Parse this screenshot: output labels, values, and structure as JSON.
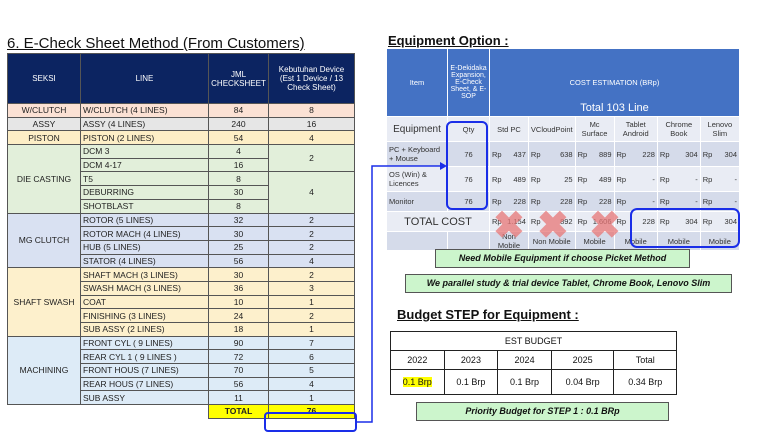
{
  "left": {
    "title": "6. E-Check Sheet Method (From Customers)",
    "headers": [
      "SEKSI",
      "LINE",
      "JML CHECKSHEET",
      "Kebutuhan Device (Est 1 Device / 13 Check Sheet)"
    ],
    "groups": [
      {
        "seksi": "W/CLUTCH",
        "cls": "wc",
        "rows": [
          [
            "W/CLUTCH (4 LINES)",
            "84"
          ]
        ],
        "dev": [
          "8"
        ]
      },
      {
        "seksi": "ASSY",
        "cls": "as",
        "rows": [
          [
            "ASSY (4 LINES)",
            "240"
          ]
        ],
        "dev": [
          "16"
        ]
      },
      {
        "seksi": "PISTON",
        "cls": "pi",
        "rows": [
          [
            "PISTON (2 LINES)",
            "54"
          ]
        ],
        "dev": [
          "4"
        ]
      },
      {
        "seksi": "DIE CASTING",
        "cls": "dc",
        "rows": [
          [
            "DCM 3",
            "4"
          ],
          [
            "DCM 4-17",
            "16"
          ],
          [
            "T5",
            "8"
          ],
          [
            "DEBURRING",
            "30"
          ],
          [
            "SHOTBLAST",
            "8"
          ]
        ],
        "devspan": [
          [
            2,
            "2"
          ],
          [
            3,
            "4"
          ]
        ]
      },
      {
        "seksi": "MG CLUTCH",
        "cls": "mg",
        "rows": [
          [
            "ROTOR (5 LINES)",
            "32"
          ],
          [
            "ROTOR MACH (4 LINES)",
            "30"
          ],
          [
            "HUB (5 LINES)",
            "25"
          ],
          [
            "STATOR (4 LINES)",
            "56"
          ]
        ],
        "dev": [
          "2",
          "2",
          "2",
          "4"
        ]
      },
      {
        "seksi": "SHAFT SWASH",
        "cls": "ss",
        "rows": [
          [
            "SHAFT MACH (3 LINES)",
            "30"
          ],
          [
            "SWASH MACH (3 LINES)",
            "36"
          ],
          [
            "COAT",
            "10"
          ],
          [
            "FINISHING (3 LINES)",
            "24"
          ],
          [
            "SUB ASSY (2 LINES)",
            "18"
          ]
        ],
        "dev": [
          "2",
          "3",
          "1",
          "2",
          "1"
        ]
      },
      {
        "seksi": "MACHINING",
        "cls": "ma",
        "rows": [
          [
            "FRONT CYL ( 9 LINES)",
            "90"
          ],
          [
            "REAR CYL 1 ( 9 LINES )",
            "72"
          ],
          [
            "FRONT HOUS (7 LINES)",
            "70"
          ],
          [
            "REAR HOUS (7 LINES)",
            "56"
          ],
          [
            "SUB ASSY",
            "11"
          ]
        ],
        "dev": [
          "7",
          "6",
          "5",
          "4",
          "1"
        ]
      }
    ],
    "total_label": "TOTAL",
    "total_value": "76"
  },
  "equip": {
    "title": "Equipment Option :",
    "h_item": "Item",
    "h_qty": "E-Dekidaka Expansion, E-Check Sheet, & E-SOP",
    "h_cost": "COST ESTIMATION (BRp)",
    "h_total": "Total 103 Line",
    "sub": [
      "Equipment",
      "Qty",
      "Std PC",
      "VCloudPoint",
      "Mc Surface",
      "Tablet Android",
      "Chrome Book",
      "Lenovo Slim"
    ],
    "rows": [
      {
        "item": "PC + Keyboard + Mouse",
        "qty": "76",
        "vals": [
          "437",
          "638",
          "889",
          "228",
          "304",
          "304"
        ]
      },
      {
        "item": "OS (Win) & Licences",
        "qty": "76",
        "vals": [
          "489",
          "25",
          "489",
          "-",
          "-",
          "-"
        ]
      },
      {
        "item": "Monitor",
        "qty": "76",
        "vals": [
          "228",
          "228",
          "228",
          "-",
          "-",
          "-"
        ]
      }
    ],
    "currency": "Rp",
    "total_label": "TOTAL COST",
    "totals": [
      "1.154",
      "892",
      "1.606",
      "228",
      "304",
      "304"
    ],
    "mobility": [
      "Non Mobile",
      "Non Mobile",
      "Mobile",
      "Mobile",
      "Mobile",
      "Mobile"
    ]
  },
  "notes": {
    "mobile": "Need Mobile Equipment if choose Picket Method",
    "trial": "We parallel study & trial device Tablet, Chrome Book, Lenovo Slim",
    "priority": "Priority Budget for STEP 1 : 0.1 BRp"
  },
  "budget": {
    "title": "Budget STEP for Equipment :",
    "header": "EST BUDGET",
    "years": [
      "2022",
      "2023",
      "2024",
      "2025",
      "Total"
    ],
    "values": [
      "0.1 Brp",
      "0.1 Brp",
      "0.1 Brp",
      "0.04 Brp",
      "0.34 Brp"
    ]
  }
}
